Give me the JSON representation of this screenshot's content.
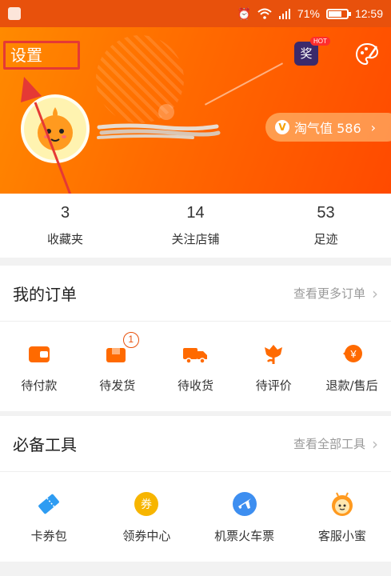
{
  "status_bar": {
    "battery": "71%",
    "time": "12:59",
    "battery_level": 0.71
  },
  "header": {
    "settings_label": "设置",
    "prize_label": "奖",
    "hot_label": "HOT",
    "naughty_badge": "V",
    "naughty_label": "淘气值 586"
  },
  "stats": [
    {
      "value": "3",
      "label": "收藏夹"
    },
    {
      "value": "14",
      "label": "关注店铺"
    },
    {
      "value": "53",
      "label": "足迹"
    }
  ],
  "orders": {
    "title": "我的订单",
    "more": "查看更多订单",
    "items": [
      {
        "label": "待付款",
        "icon": "wallet-icon"
      },
      {
        "label": "待发货",
        "icon": "package-icon",
        "badge": "1"
      },
      {
        "label": "待收货",
        "icon": "truck-icon"
      },
      {
        "label": "待评价",
        "icon": "flower-icon"
      },
      {
        "label": "退款/售后",
        "icon": "refund-icon"
      }
    ]
  },
  "tools": {
    "title": "必备工具",
    "more": "查看全部工具",
    "items": [
      {
        "label": "卡券包",
        "icon": "ticket-icon"
      },
      {
        "label": "领券中心",
        "icon": "coupon-icon",
        "glyph": "券"
      },
      {
        "label": "机票火车票",
        "icon": "plane-icon"
      },
      {
        "label": "客服小蜜",
        "icon": "bee-icon"
      }
    ]
  },
  "colors": {
    "accent": "#ff5000",
    "annotation": "#e53935"
  }
}
